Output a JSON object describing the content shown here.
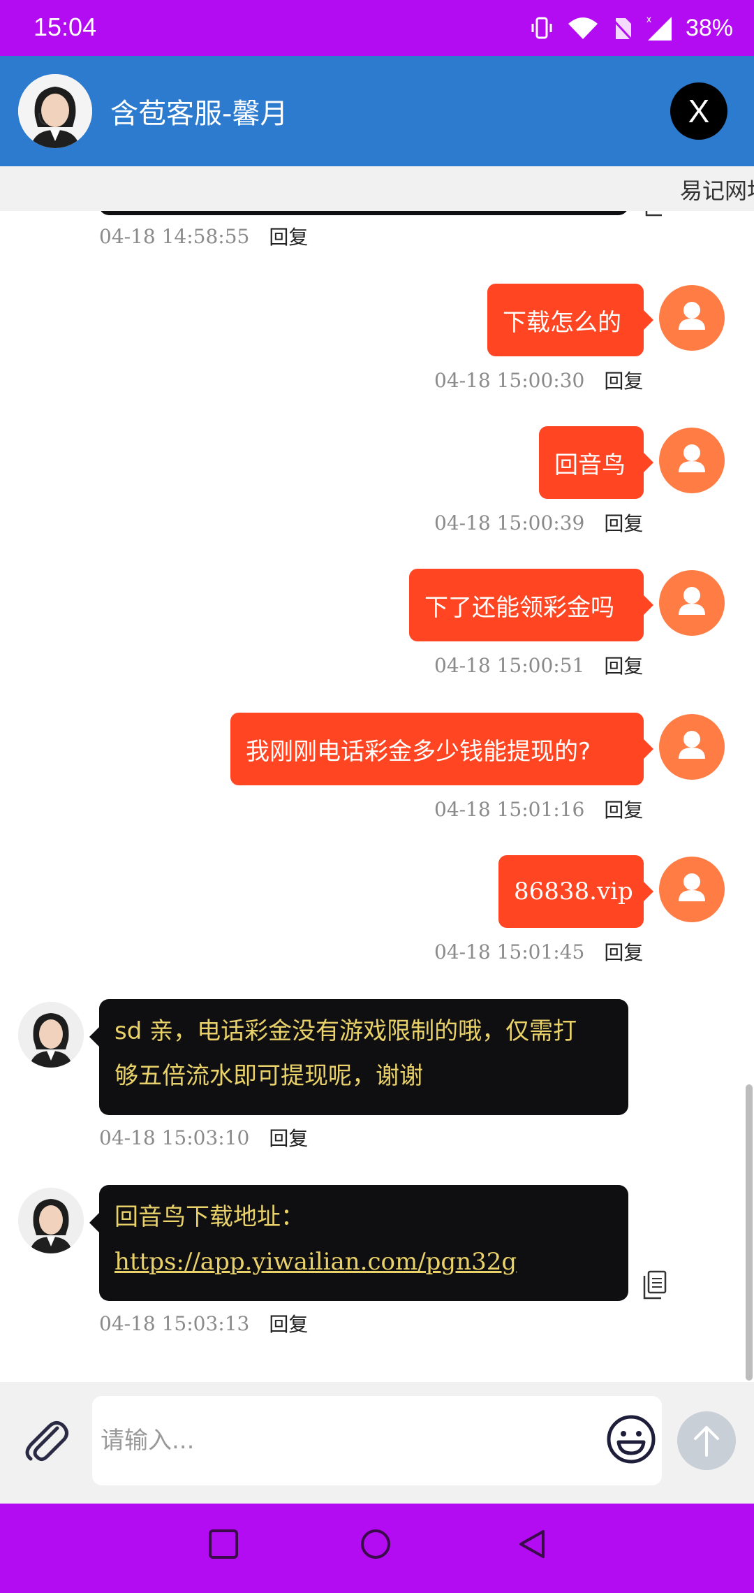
{
  "status_bar": {
    "time": "15:04",
    "battery": "38%"
  },
  "header": {
    "title": "含苞客服-馨月",
    "close_label": "X"
  },
  "marquee": {
    "text": "易记网址"
  },
  "messages": [
    {
      "time": "04-18 15:00:30",
      "reply": "回复",
      "text": "下载怎么的"
    },
    {
      "time": "04-18 15:00:39",
      "reply": "回复",
      "text": "回音鸟"
    },
    {
      "time": "04-18 15:00:51",
      "reply": "回复",
      "text": "下了还能领彩金吗"
    },
    {
      "time": "04-18 15:01:16",
      "reply": "回复",
      "text": "我刚刚电话彩金多少钱能提现的?"
    },
    {
      "time": "04-18 15:01:45",
      "reply": "回复",
      "text": "86838.vip"
    }
  ],
  "first_meta": {
    "time": "04-18 14:58:55",
    "reply": "回复"
  },
  "agent_messages": [
    {
      "time": "04-18 15:03:10",
      "reply": "回复",
      "line1": "sd 亲，电话彩金没有游戏限制的哦，仅需打",
      "line2": "够五倍流水即可提现呢，谢谢"
    },
    {
      "time": "04-18 15:03:13",
      "reply": "回复",
      "line1": "回音鸟下载地址：",
      "link": "https://app.yiwailian.com/pgn32g"
    }
  ],
  "input": {
    "placeholder": "请输入..."
  },
  "icons": {
    "attach": "paperclip-icon",
    "emoji": "smiley-icon",
    "send": "arrow-up-icon",
    "copy": "copy-icon"
  },
  "colors": {
    "status_bar": "#b30cf2",
    "header": "#2d7bcf",
    "outgoing_bubble": "#ff4521",
    "outgoing_avatar": "#ff7d45",
    "incoming_bubble": "#0f0e11",
    "incoming_text": "#e9d26a"
  }
}
